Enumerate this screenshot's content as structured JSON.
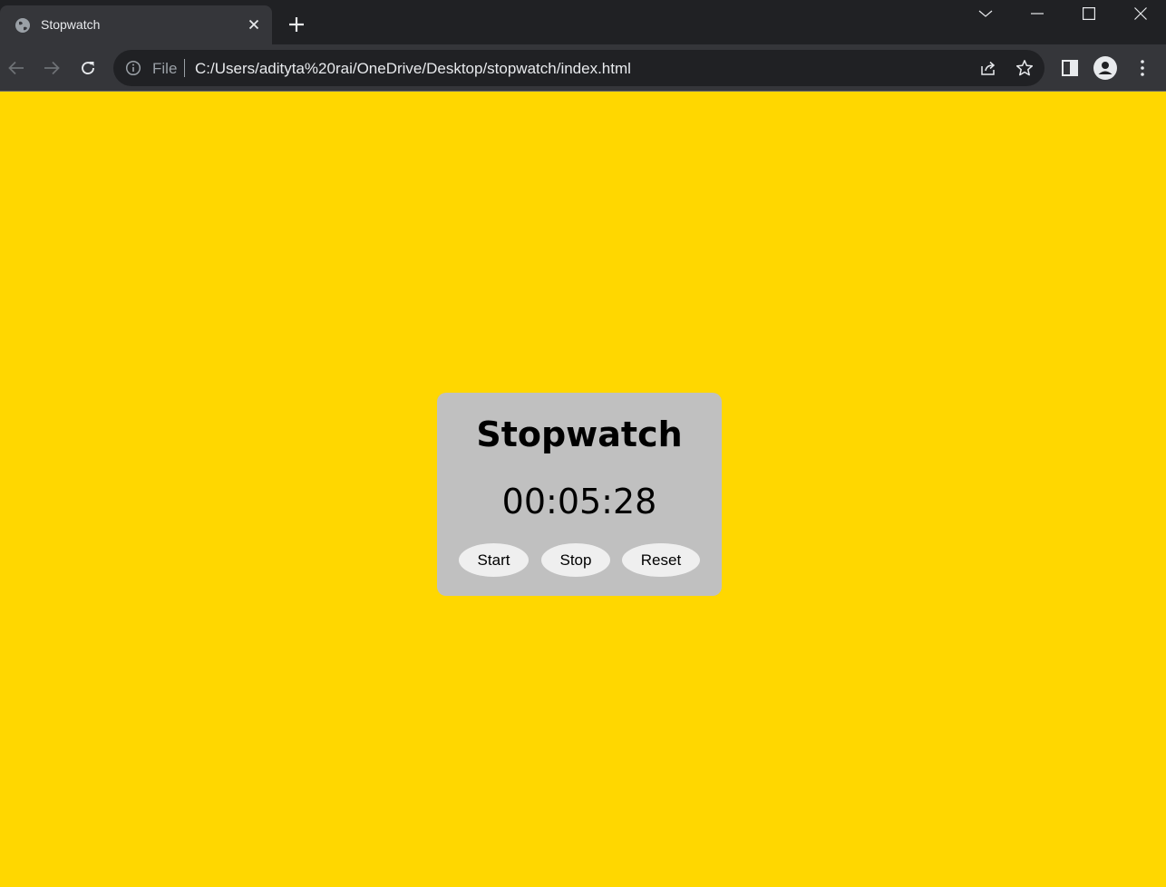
{
  "browser": {
    "tab": {
      "title": "Stopwatch",
      "favicon": "globe-icon",
      "close_icon": "close-icon"
    },
    "new_tab_icon": "plus-icon",
    "window_controls": [
      "chevron-down-icon",
      "minimize-icon",
      "maximize-icon",
      "close-icon"
    ],
    "toolbar": {
      "back_icon": "back-arrow-icon",
      "forward_icon": "forward-arrow-icon",
      "reload_icon": "reload-icon",
      "site_info_icon": "info-icon",
      "scheme_label": "File",
      "url": "C:/Users/adityta%20rai/OneDrive/Desktop/stopwatch/index.html",
      "share_icon": "share-icon",
      "bookmark_icon": "star-icon",
      "side_panel_icon": "side-panel-icon",
      "profile_icon": "profile-icon",
      "menu_icon": "kebab-menu-icon"
    }
  },
  "page": {
    "background_color": "#ffd700",
    "card_color": "#c0c0c0",
    "title": "Stopwatch",
    "time": "00:05:28",
    "buttons": {
      "start": "Start",
      "stop": "Stop",
      "reset": "Reset"
    }
  }
}
